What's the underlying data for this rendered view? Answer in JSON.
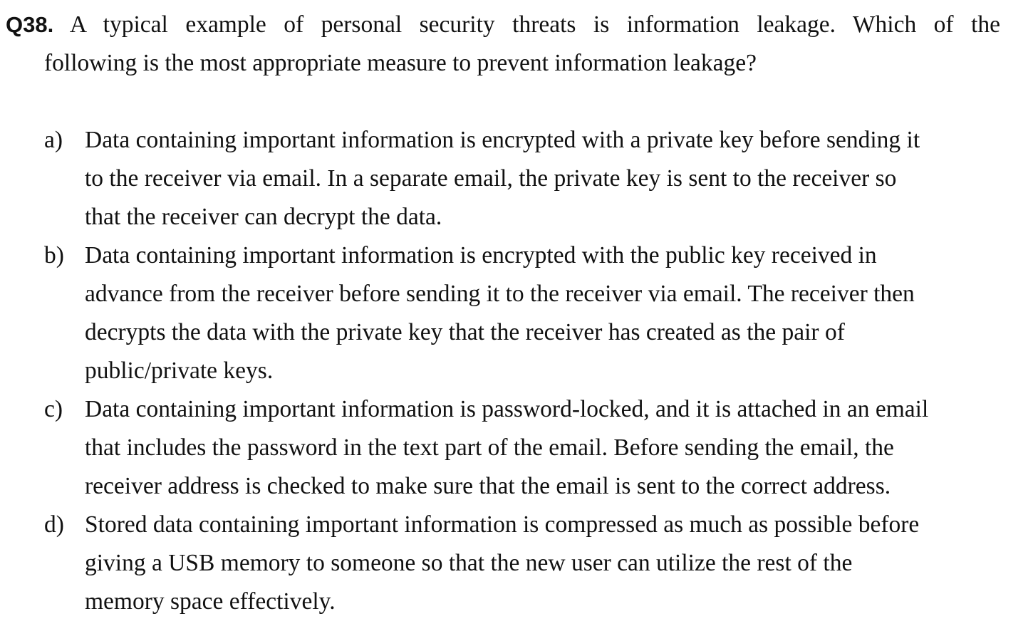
{
  "question": {
    "number": "Q38.",
    "text_line1": "A typical example of personal security threats is information leakage. Which of the",
    "text_line2": "following is the most appropriate measure to prevent information leakage?"
  },
  "options": [
    {
      "letter": "a)",
      "lines": [
        "Data containing important information is encrypted with a private key before sending it",
        "to the receiver via email. In a separate email, the private key is sent to the receiver so",
        "that the receiver can decrypt the data."
      ]
    },
    {
      "letter": "b)",
      "lines": [
        "Data containing important information is encrypted with the public key received in",
        "advance from the receiver before sending it to the receiver via email. The receiver then",
        "decrypts the data with the private key that the receiver has created as the pair of",
        "public/private keys."
      ]
    },
    {
      "letter": "c)",
      "lines": [
        "Data containing important information is password-locked, and it is attached in an email",
        "that includes the password in the text part of the email. Before sending the email, the",
        "receiver address is checked to make sure that the email is sent to the correct address."
      ]
    },
    {
      "letter": "d)",
      "lines": [
        "Stored data containing important information is compressed as much as possible before",
        "giving a USB memory to someone so that the new user can utilize the rest of the",
        "memory space effectively."
      ]
    }
  ]
}
